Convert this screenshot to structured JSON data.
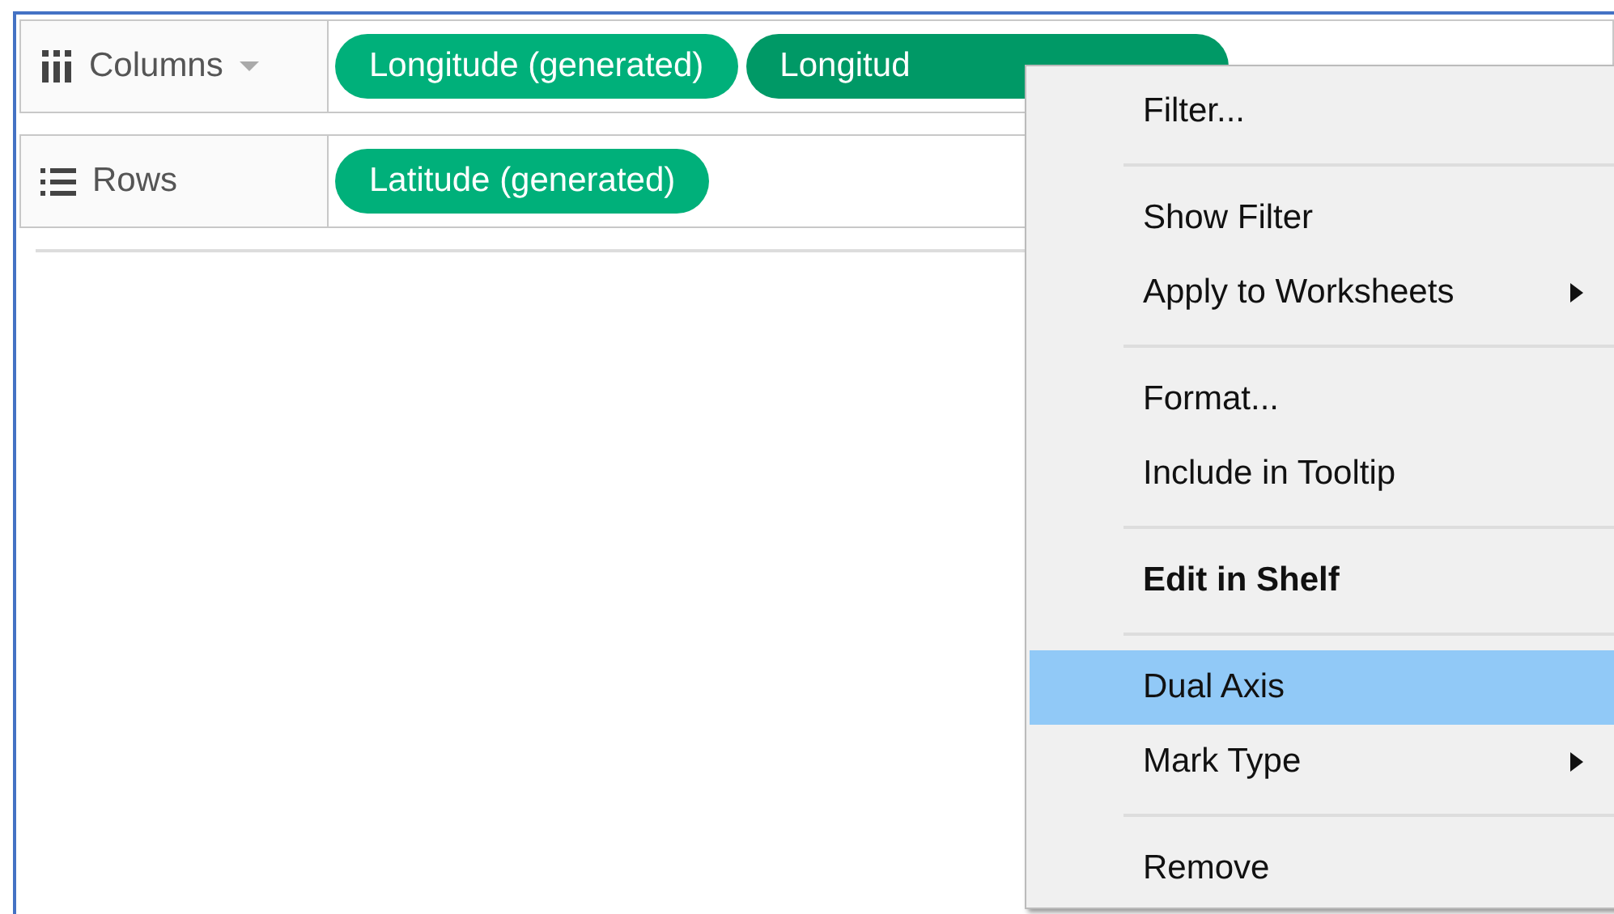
{
  "shelves": [
    {
      "kind": "columns",
      "label": "Columns",
      "dropdown": true,
      "pills": [
        {
          "text": "Longitude (generated)",
          "selected": false
        },
        {
          "text": "Longitud",
          "selected": true
        }
      ]
    },
    {
      "kind": "rows",
      "label": "Rows",
      "pills": [
        {
          "text": "Latitude (generated)",
          "selected": false
        }
      ]
    }
  ],
  "context_menu": {
    "items": [
      {
        "kind": "item",
        "label": "Filter...",
        "bold": false,
        "selected": false,
        "submenu": false
      },
      {
        "kind": "separator"
      },
      {
        "kind": "item",
        "label": "Show Filter",
        "bold": false,
        "selected": false,
        "submenu": false
      },
      {
        "kind": "item",
        "label": "Apply to Worksheets",
        "bold": false,
        "selected": false,
        "submenu": true
      },
      {
        "kind": "separator"
      },
      {
        "kind": "item",
        "label": "Format...",
        "bold": false,
        "selected": false,
        "submenu": false
      },
      {
        "kind": "item",
        "label": "Include in Tooltip",
        "bold": false,
        "selected": false,
        "submenu": false
      },
      {
        "kind": "separator"
      },
      {
        "kind": "item",
        "label": "Edit in Shelf",
        "bold": true,
        "selected": false,
        "submenu": false
      },
      {
        "kind": "separator"
      },
      {
        "kind": "item",
        "label": "Dual Axis",
        "bold": false,
        "selected": true,
        "submenu": false
      },
      {
        "kind": "item",
        "label": "Mark Type",
        "bold": false,
        "selected": false,
        "submenu": true
      },
      {
        "kind": "separator"
      },
      {
        "kind": "item",
        "label": "Remove",
        "bold": false,
        "selected": false,
        "submenu": false
      }
    ]
  }
}
